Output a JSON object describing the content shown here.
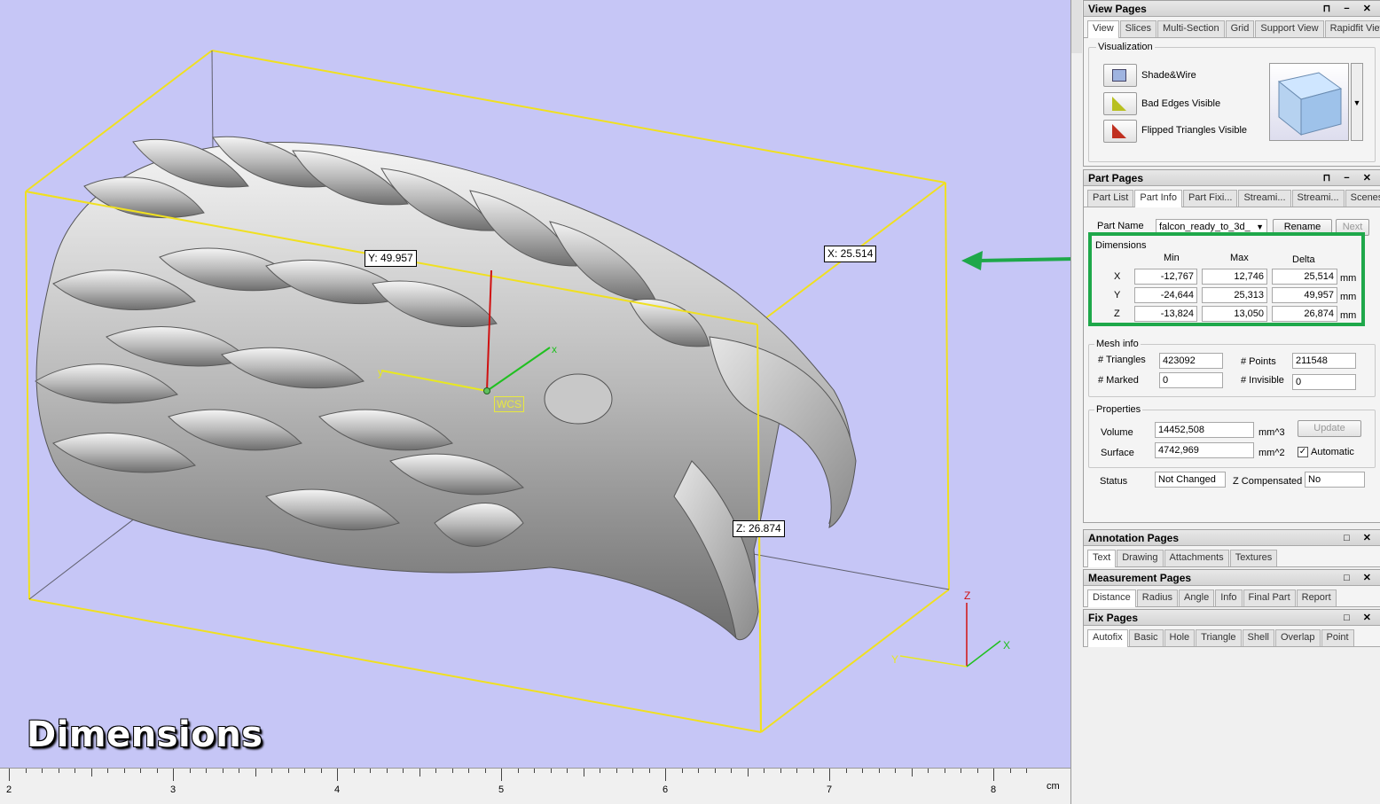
{
  "viewport": {
    "dim_labels": {
      "x": "X: 25.514",
      "y": "Y: 49.957",
      "z": "Z: 26.874"
    },
    "wcs_label": "WCS",
    "overlay_title": "Dimensions",
    "axis_labels": {
      "x": "x",
      "y": "y",
      "corner_x": "X",
      "corner_y": "Y",
      "corner_z": "Z"
    },
    "ruler": {
      "ticks": [
        "2",
        "3",
        "4",
        "5",
        "6",
        "7",
        "8"
      ],
      "unit": "cm"
    },
    "colors": {
      "background": "#c6c6f6",
      "bounding_box": "#f0e020",
      "arrow": "#1ea84a"
    }
  },
  "view_pages": {
    "title": "View Pages",
    "tabs": [
      "View",
      "Slices",
      "Multi-Section",
      "Grid",
      "Support View",
      "Rapidfit View"
    ],
    "group": "Visualization",
    "items": [
      {
        "label": "Shade&Wire",
        "icon": "shade-wire-icon"
      },
      {
        "label": "Bad Edges Visible",
        "icon": "bad-edges-icon"
      },
      {
        "label": "Flipped Triangles Visible",
        "icon": "flipped-triangles-icon"
      }
    ]
  },
  "part_pages": {
    "title": "Part Pages",
    "tabs": [
      "Part List",
      "Part Info",
      "Part Fixi...",
      "Streami...",
      "Streami...",
      "Scenes"
    ],
    "part_name_label": "Part Name",
    "part_name_value": "falcon_ready_to_3d_",
    "rename": "Rename",
    "next": "Next",
    "dimensions": {
      "label": "Dimensions",
      "headers": {
        "min": "Min",
        "max": "Max",
        "delta": "Delta"
      },
      "rows": [
        {
          "axis": "X",
          "min": "-12,767",
          "max": "12,746",
          "delta": "25,514",
          "unit": "mm"
        },
        {
          "axis": "Y",
          "min": "-24,644",
          "max": "25,313",
          "delta": "49,957",
          "unit": "mm"
        },
        {
          "axis": "Z",
          "min": "-13,824",
          "max": "13,050",
          "delta": "26,874",
          "unit": "mm"
        }
      ]
    },
    "mesh_info": {
      "label": "Mesh info",
      "triangles_label": "# Triangles",
      "triangles": "423092",
      "points_label": "# Points",
      "points": "211548",
      "marked_label": "# Marked",
      "marked": "0",
      "invisible_label": "# Invisible",
      "invisible": "0"
    },
    "properties": {
      "label": "Properties",
      "volume_label": "Volume",
      "volume": "14452,508",
      "volume_unit": "mm^3",
      "surface_label": "Surface",
      "surface": "4742,969",
      "surface_unit": "mm^2",
      "update": "Update",
      "automatic": "Automatic"
    },
    "status_label": "Status",
    "status": "Not Changed",
    "zcomp_label": "Z Compensated",
    "zcomp": "No"
  },
  "annotation_pages": {
    "title": "Annotation Pages",
    "tabs": [
      "Text",
      "Drawing",
      "Attachments",
      "Textures"
    ]
  },
  "measurement_pages": {
    "title": "Measurement Pages",
    "tabs": [
      "Distance",
      "Radius",
      "Angle",
      "Info",
      "Final Part",
      "Report"
    ]
  },
  "fix_pages": {
    "title": "Fix Pages",
    "tabs": [
      "Autofix",
      "Basic",
      "Hole",
      "Triangle",
      "Shell",
      "Overlap",
      "Point"
    ]
  }
}
